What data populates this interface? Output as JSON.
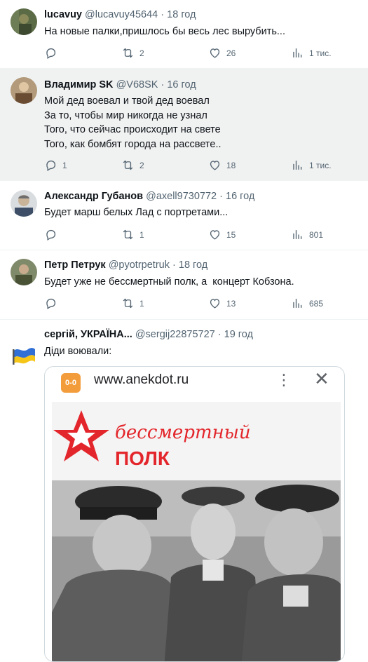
{
  "tweets": [
    {
      "name": "lucavuy",
      "handle": "@lucavuy45644",
      "sep": "·",
      "time": "18 год",
      "text": "На новые палки,пришлось бы весь лес вырубить...",
      "replies": "",
      "retweets": "2",
      "likes": "26",
      "views": "1 тис."
    },
    {
      "name": "Владимир SK",
      "handle": "@V68SK",
      "sep": "·",
      "time": "16 год",
      "text": "Мой дед воевал и твой дед воевал\nЗа то, чтобы мир никогда не узнал\nТого, что сейчас происходит на свете\nТого, как бомбят города на рассвете..",
      "replies": "1",
      "retweets": "2",
      "likes": "18",
      "views": "1 тис."
    },
    {
      "name": "Александр Губанов",
      "handle": "@axell9730772",
      "sep": "·",
      "time": "16 год",
      "text": "Будет марш белых Лад с портретами...",
      "replies": "",
      "retweets": "1",
      "likes": "15",
      "views": "801"
    },
    {
      "name": "Петр Петрук",
      "handle": "@pyotrpetruk",
      "sep": "·",
      "time": "18 год",
      "text": "Будет уже не бессмертный полк, а  концерт Кобзона.",
      "replies": "",
      "retweets": "1",
      "likes": "13",
      "views": "685"
    },
    {
      "name": "сергій, УКРАЇНА...",
      "handle": "@sergij22875727",
      "sep": "·",
      "time": "19 год",
      "text": "Діди воювали:"
    }
  ],
  "card": {
    "logo_text": "0-0",
    "url": "www.anekdot.ru",
    "menu_glyph": "⋮",
    "close_glyph": "✕",
    "banner_line1": "бессмертный",
    "banner_line2": "ПОЛК"
  },
  "icons": {
    "reply": "reply-icon",
    "retweet": "retweet-icon",
    "like": "heart-icon",
    "views": "views-icon"
  },
  "colors": {
    "accent_red": "#e3262b",
    "text": "#0f1419",
    "muted": "#536471",
    "shade": "#f0f1f1"
  }
}
